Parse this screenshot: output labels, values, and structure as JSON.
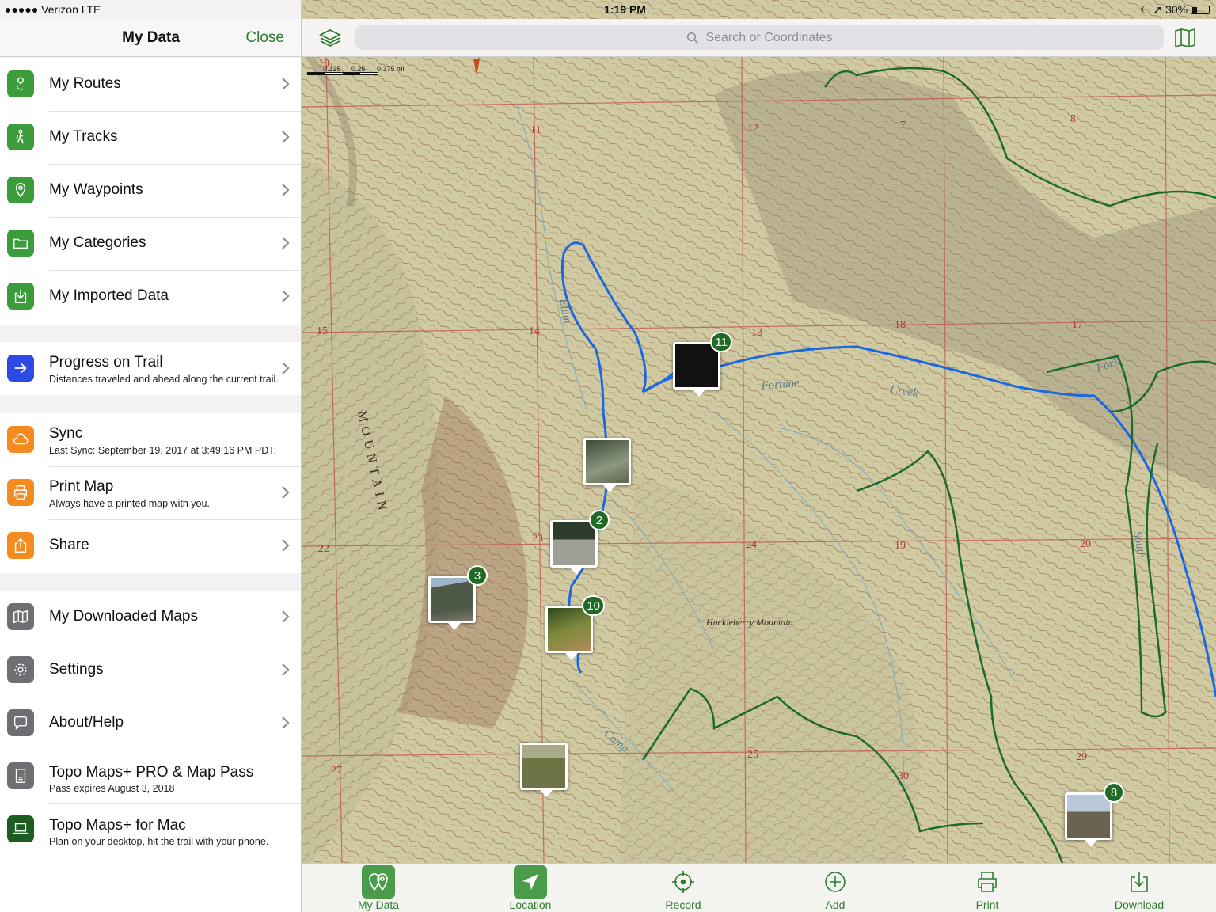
{
  "status_bar": {
    "carrier": "●●●●● Verizon  LTE",
    "time": "1:19 PM",
    "battery": "30%"
  },
  "sidebar": {
    "title": "My Data",
    "close_label": "Close",
    "groups": [
      {
        "items": [
          {
            "label": "My Routes",
            "icon": "route-icon",
            "color": "#3a9c3a"
          },
          {
            "label": "My Tracks",
            "icon": "hiker-icon",
            "color": "#3a9c3a"
          },
          {
            "label": "My Waypoints",
            "icon": "waypoint-pin-icon",
            "color": "#3a9c3a"
          },
          {
            "label": "My Categories",
            "icon": "folder-icon",
            "color": "#3a9c3a"
          },
          {
            "label": "My Imported Data",
            "icon": "import-icon",
            "color": "#3a9c3a"
          }
        ]
      },
      {
        "items": [
          {
            "label": "Progress on Trail",
            "sub": "Distances traveled and ahead along the current trail.",
            "icon": "arrow-right-icon",
            "color": "#2d49e6"
          }
        ]
      },
      {
        "items": [
          {
            "label": "Sync",
            "sub": "Last Sync: September 19, 2017 at 3:49:16 PM PDT.",
            "icon": "cloud-icon",
            "color": "#f58a1f"
          },
          {
            "label": "Print Map",
            "sub": "Always have a printed map with you.",
            "icon": "printer-icon",
            "color": "#f58a1f"
          },
          {
            "label": "Share",
            "icon": "share-icon",
            "color": "#f58a1f"
          }
        ]
      },
      {
        "items": [
          {
            "label": "My Downloaded Maps",
            "icon": "map-icon",
            "color": "#6f6f73"
          },
          {
            "label": "Settings",
            "icon": "gear-icon",
            "color": "#6f6f73"
          },
          {
            "label": "About/Help",
            "icon": "chat-bubble-icon",
            "color": "#6f6f73"
          },
          {
            "label": "Topo Maps+ PRO & Map Pass",
            "sub": "Pass expires August 3, 2018",
            "icon": "pass-card-icon",
            "color": "#6f6f73"
          },
          {
            "label": "Topo Maps+ for Mac",
            "sub": "Plan on your desktop, hit the trail with your phone.",
            "icon": "laptop-icon",
            "color": "#1c5e22"
          }
        ]
      }
    ]
  },
  "map": {
    "search_placeholder": "Search or Coordinates",
    "scale_labels": [
      "0.125",
      "0.25",
      "0.375 mi"
    ],
    "labels": {
      "fortune": "Fortune",
      "creek": "Creek",
      "huckleberry": "Huckleberry Mountain",
      "mountain": "MOUNTAIN",
      "elum": "Elum",
      "camp": "Camp",
      "south": "South",
      "fork": "Fork"
    },
    "section_numbers": [
      "10",
      "11",
      "12",
      "7",
      "8",
      "14",
      "13",
      "18",
      "17",
      "15",
      "23",
      "24",
      "19",
      "20",
      "22",
      "25",
      "30",
      "29",
      "27"
    ],
    "photo_waypoints": [
      {
        "badge": "11",
        "thumb_color": "#111111"
      },
      {
        "badge": "",
        "thumb_color": "#6d7a5e"
      },
      {
        "badge": "2",
        "thumb_color": "#8a8f86"
      },
      {
        "badge": "3",
        "thumb_color": "#6d7462"
      },
      {
        "badge": "10",
        "thumb_color": "#5e6e3a"
      },
      {
        "badge": "",
        "thumb_color": "#7c7f4c"
      },
      {
        "badge": "8",
        "thumb_color": "#8a8a74"
      }
    ]
  },
  "tabs": [
    {
      "label": "My Data",
      "icon": "my-data-icon",
      "active": true
    },
    {
      "label": "Location",
      "icon": "location-arrow-icon",
      "active": false
    },
    {
      "label": "Record",
      "icon": "record-target-icon",
      "active": false
    },
    {
      "label": "Add",
      "icon": "add-circle-icon",
      "active": false
    },
    {
      "label": "Print",
      "icon": "print-icon",
      "active": false
    },
    {
      "label": "Download",
      "icon": "download-icon",
      "active": false
    }
  ],
  "colors": {
    "accent": "#2e7d2e",
    "map_terrain": "#cbc9a0",
    "map_blue_track": "#1d68e0",
    "map_green_trail": "#1e6a2a",
    "grid_red": "#c0504d"
  }
}
